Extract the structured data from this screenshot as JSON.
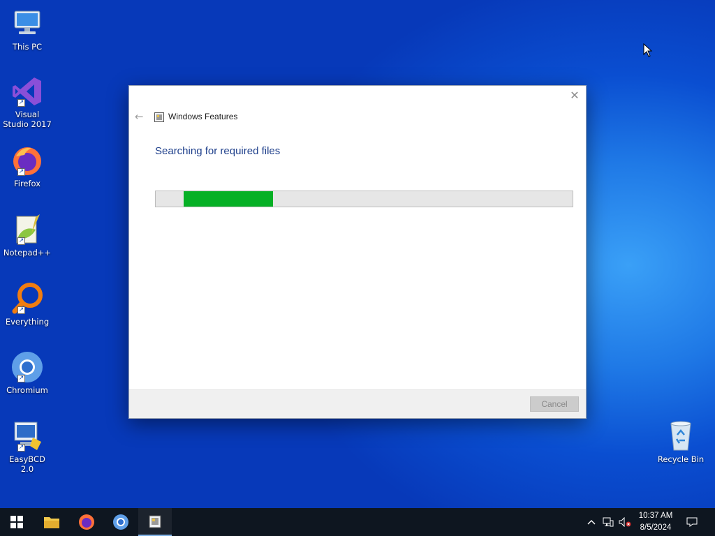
{
  "desktop": {
    "icons": [
      {
        "label": "This PC"
      },
      {
        "label": "Visual Studio 2017"
      },
      {
        "label": "Firefox"
      },
      {
        "label": "Notepad++"
      },
      {
        "label": "Everything"
      },
      {
        "label": "Chromium"
      },
      {
        "label": "EasyBCD 2.0"
      },
      {
        "label": "Recycle Bin"
      }
    ]
  },
  "dialog": {
    "title": "Windows Features",
    "heading": "Searching for required files",
    "progress": 0.28,
    "progress_color": "#06b025",
    "cancel_label": "Cancel",
    "cancel_enabled": false
  },
  "taskbar": {
    "items": [
      {
        "icon": "windows-start-icon"
      },
      {
        "icon": "file-explorer-icon"
      },
      {
        "icon": "firefox-icon"
      },
      {
        "icon": "chromium-icon"
      },
      {
        "icon": "windows-features-icon",
        "active": true
      }
    ],
    "clock": {
      "time": "10:37 AM",
      "date": "8/5/2024"
    }
  },
  "colors": {
    "accent": "#0a4ed1",
    "heading": "#1e3f8b"
  }
}
